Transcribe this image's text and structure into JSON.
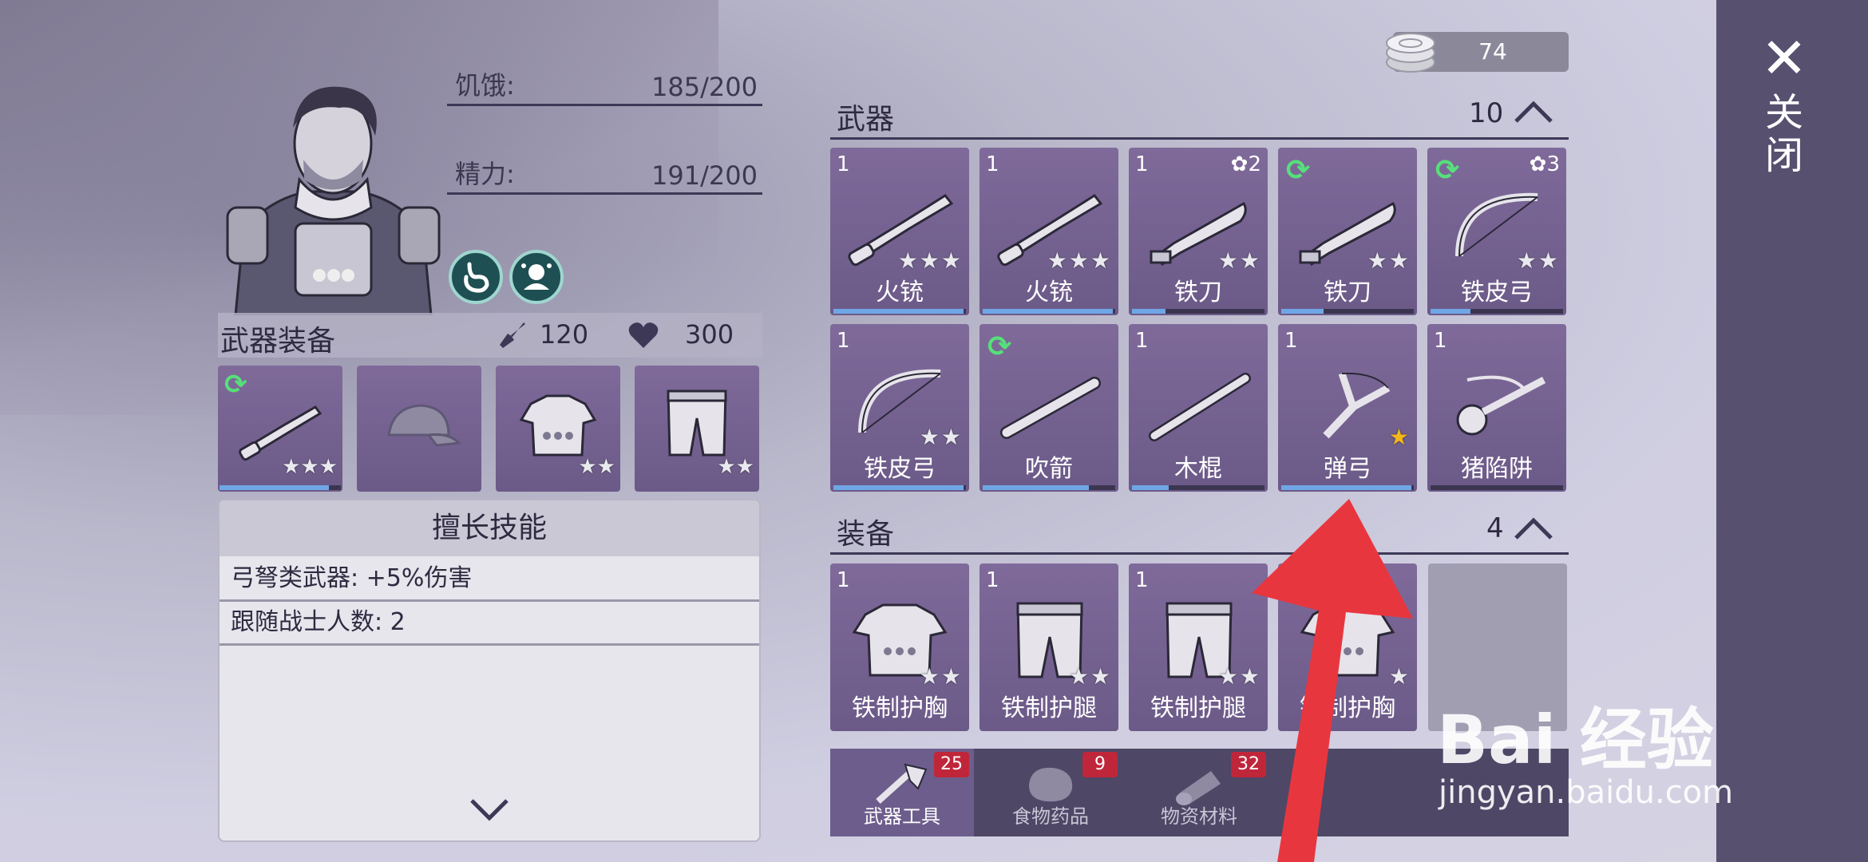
{
  "coins": {
    "value": "74"
  },
  "close": {
    "label": "关闭"
  },
  "character": {
    "hunger_label": "饥饿:",
    "hunger_value": "185/200",
    "energy_label": "精力:",
    "energy_value": "191/200"
  },
  "equipment": {
    "title": "武器装备",
    "attack": "120",
    "health": "300",
    "slots": [
      {
        "stars": "★★★",
        "progress": 0.9
      },
      {
        "stars": ""
      },
      {
        "stars": "★★"
      },
      {
        "stars": "★★"
      }
    ]
  },
  "skills": {
    "title": "擅长技能",
    "rows": [
      "弓弩类武器: +5%伤害",
      "跟随战士人数: 2"
    ]
  },
  "weapons": {
    "title": "武器",
    "count": "10",
    "items": [
      {
        "level": "1",
        "name": "火铳",
        "stars": "★★★",
        "gear": "",
        "upgrade": false,
        "progress": 0.98
      },
      {
        "level": "1",
        "name": "火铳",
        "stars": "★★★",
        "gear": "",
        "upgrade": false,
        "progress": 0.98
      },
      {
        "level": "1",
        "name": "铁刀",
        "stars": "★★",
        "gear": "✿2",
        "upgrade": false,
        "progress": 0.25
      },
      {
        "level": "",
        "name": "铁刀",
        "stars": "★★",
        "gear": "",
        "upgrade": true,
        "progress": 0.32
      },
      {
        "level": "",
        "name": "铁皮弓",
        "stars": "★★",
        "gear": "✿3",
        "upgrade": true,
        "progress": 0.3
      },
      {
        "level": "1",
        "name": "铁皮弓",
        "stars": "★★",
        "gear": "",
        "upgrade": false,
        "progress": 0.98
      },
      {
        "level": "",
        "name": "吹箭",
        "stars": "",
        "gear": "",
        "upgrade": true,
        "progress": 0.8
      },
      {
        "level": "1",
        "name": "木棍",
        "stars": "",
        "gear": "",
        "upgrade": false,
        "progress": 0.28
      },
      {
        "level": "1",
        "name": "弹弓",
        "stars": "★",
        "gear": "",
        "upgrade": false,
        "progress": 0.98,
        "gold": true
      },
      {
        "level": "1",
        "name": "猪陷阱",
        "stars": "",
        "gear": "",
        "upgrade": false,
        "progress": 0
      }
    ]
  },
  "gear": {
    "title": "装备",
    "count": "4",
    "items": [
      {
        "level": "1",
        "name": "铁制护胸",
        "stars": "★★"
      },
      {
        "level": "1",
        "name": "铁制护腿",
        "stars": "★★"
      },
      {
        "level": "1",
        "name": "铁制护腿",
        "stars": "★★"
      },
      {
        "level": "",
        "name": "铁制护胸",
        "stars": "★"
      }
    ]
  },
  "tabs": [
    {
      "label": "武器工具",
      "badge": "25"
    },
    {
      "label": "食物药品",
      "badge": "9"
    },
    {
      "label": "物资材料",
      "badge": "32"
    }
  ],
  "watermark": {
    "brand": "Bai 经验",
    "url": "jingyan.baidu.com"
  },
  "colors": {
    "card": "#6b5a88",
    "sidebar": "#57506f",
    "progress": "#6fa7e6",
    "badge": "#c0263a",
    "arrow": "#e8363f"
  }
}
